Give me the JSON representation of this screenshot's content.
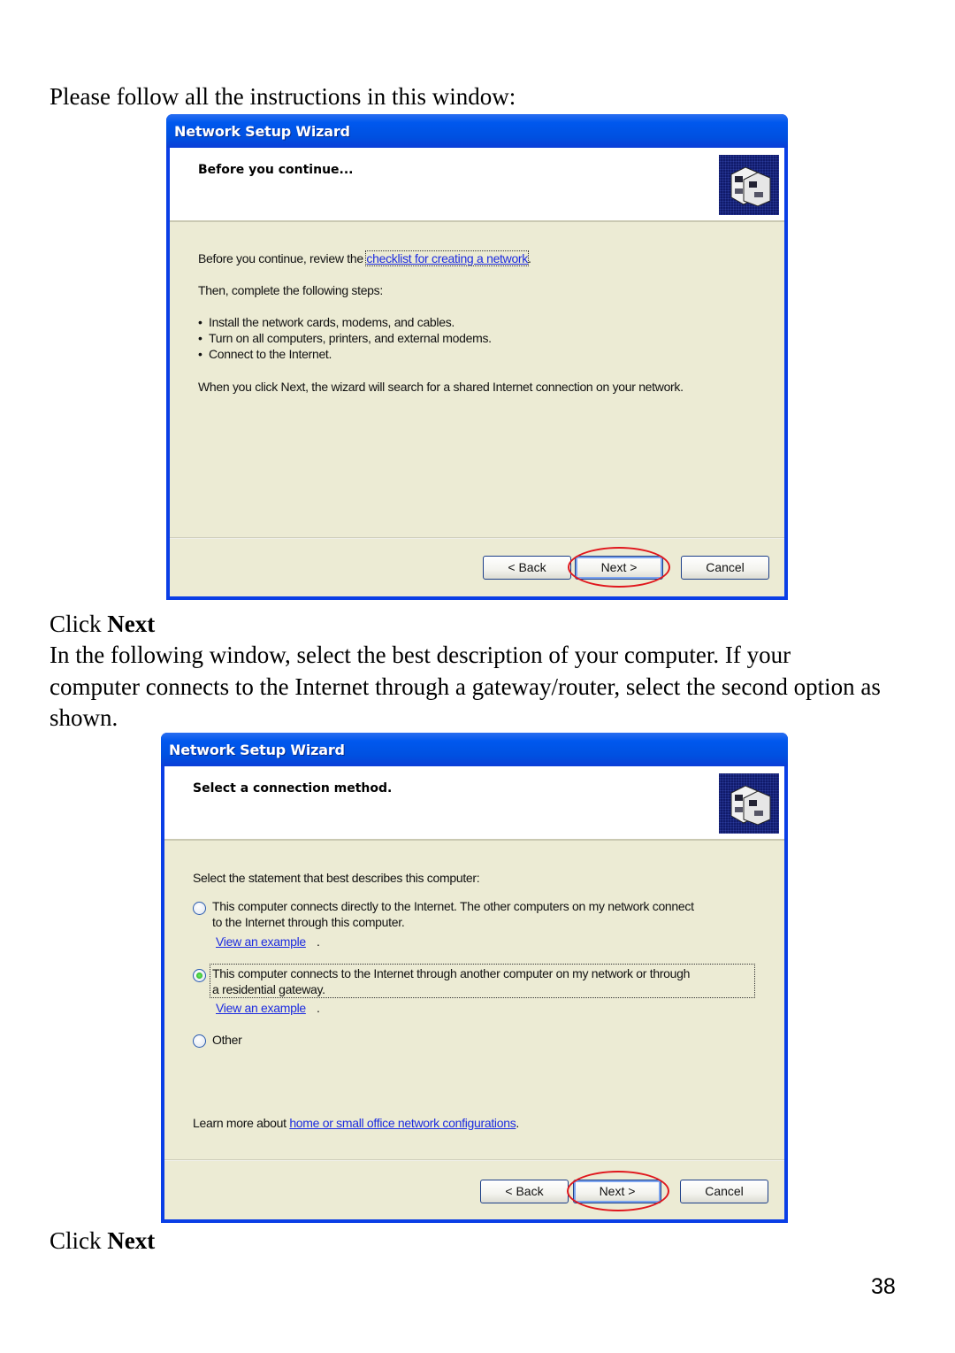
{
  "document": {
    "intro": "Please follow all the instructions in this window:",
    "step1_click_prefix": "Click ",
    "step1_click_bold": "Next",
    "paragraph": "In the following window, select the best description of your computer.  If your computer connects to the Internet through a gateway/router, select the second option as shown.",
    "step2_click_prefix": "Click ",
    "step2_click_bold": "Next",
    "page_number": "38"
  },
  "wizard1": {
    "title": "Network Setup Wizard",
    "heading": "Before you continue...",
    "icon": "network-computers-icon",
    "review_prefix": "Before you continue, review the ",
    "review_link": "checklist for creating a network",
    "review_suffix": ".",
    "steps_intro": "Then, complete the following steps:",
    "steps": [
      "Install the network cards, modems, and cables.",
      "Turn on all computers, printers, and external modems.",
      "Connect to the Internet."
    ],
    "note": "When you click Next, the wizard will search for a shared Internet connection on your network.",
    "buttons": {
      "back": "< Back",
      "next": "Next >",
      "cancel": "Cancel"
    }
  },
  "wizard2": {
    "title": "Network Setup Wizard",
    "heading": "Select a connection method.",
    "icon": "network-computers-icon",
    "prompt": "Select the statement that best describes this computer:",
    "options": [
      {
        "line1": "This computer connects directly to the Internet. The other computers on my network connect",
        "line2": "to the Internet through this computer.",
        "link": "View an example",
        "selected": false
      },
      {
        "line1": "This computer connects to the Internet through another computer on my network or through",
        "line2": "a residential gateway.",
        "link": "View an example",
        "selected": true
      },
      {
        "line1": "Other",
        "selected": false
      }
    ],
    "learn_prefix": "Learn more about ",
    "learn_link": "home or small office network configurations",
    "learn_suffix": ".",
    "buttons": {
      "back": "< Back",
      "next": "Next >",
      "cancel": "Cancel"
    }
  },
  "annotation": {
    "highlight_color": "#e0171d",
    "highlighted_button": "Next >"
  }
}
